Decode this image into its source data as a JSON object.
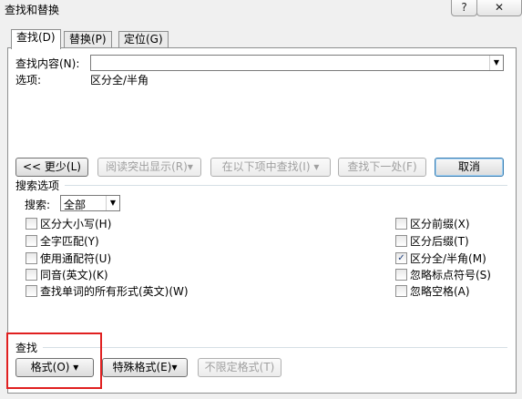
{
  "window": {
    "title": "查找和替换",
    "help_label": "?",
    "close_label": "✕"
  },
  "tabs": [
    {
      "label": "查找(D)",
      "active": true
    },
    {
      "label": "替换(P)",
      "active": false
    },
    {
      "label": "定位(G)",
      "active": false
    }
  ],
  "find": {
    "content_label": "查找内容(N):",
    "content_value": "",
    "options_label": "选项:",
    "options_value": "区分全/半角"
  },
  "buttons": {
    "less": "<< 更少(L)",
    "reading_highlight": "阅读突出显示(R)▾",
    "find_in": "在以下项中查找(I) ▾",
    "find_next": "查找下一处(F)",
    "cancel": "取消"
  },
  "search_options": {
    "section_label": "搜索选项",
    "search_label": "搜索:",
    "search_value": "全部",
    "left": [
      {
        "label": "区分大小写(H)",
        "checked": false
      },
      {
        "label": "全字匹配(Y)",
        "checked": false
      },
      {
        "label": "使用通配符(U)",
        "checked": false
      },
      {
        "label": "同音(英文)(K)",
        "checked": false
      },
      {
        "label": "查找单词的所有形式(英文)(W)",
        "checked": false
      }
    ],
    "right": [
      {
        "label": "区分前缀(X)",
        "checked": false
      },
      {
        "label": "区分后缀(T)",
        "checked": false
      },
      {
        "label": "区分全/半角(M)",
        "checked": true
      },
      {
        "label": "忽略标点符号(S)",
        "checked": false
      },
      {
        "label": "忽略空格(A)",
        "checked": false
      }
    ]
  },
  "find_section": {
    "label": "查找",
    "format": "格式(O) ▾",
    "special": "特殊格式(E)▾",
    "no_format": "不限定格式(T)"
  },
  "colors": {
    "highlight_box": "#e02020",
    "check_mark": "#1c3d7a"
  }
}
